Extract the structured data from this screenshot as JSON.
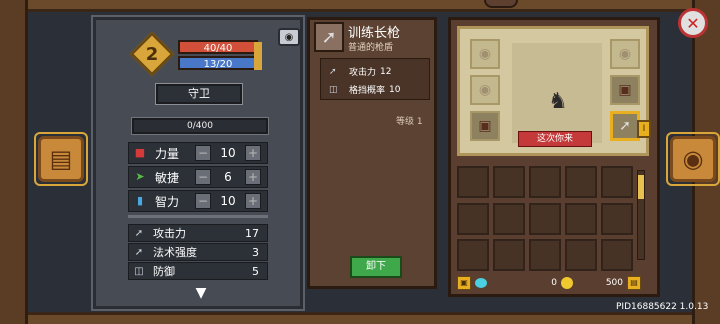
{
  "hero": {
    "level": "2",
    "hp": "40/40",
    "mp": "13/20",
    "role": "守卫",
    "xp": "0/400",
    "camera_icon": "camera-icon"
  },
  "attributes": [
    {
      "name": "力量",
      "value": "10",
      "icon": "strength-icon",
      "color": "#d43a3a"
    },
    {
      "name": "敏捷",
      "value": "6",
      "icon": "agility-icon",
      "color": "#5ab84a"
    },
    {
      "name": "智力",
      "value": "10",
      "icon": "intellect-icon",
      "color": "#4aa8e0"
    }
  ],
  "attr_controls": {
    "minus": "−",
    "plus": "+"
  },
  "stats": [
    {
      "name": "攻击力",
      "value": "17",
      "icon": "sword-icon"
    },
    {
      "name": "法术强度",
      "value": "3",
      "icon": "wand-icon"
    },
    {
      "name": "防御",
      "value": "5",
      "icon": "shield-icon"
    }
  ],
  "item": {
    "name": "训练长枪",
    "type": "普通的枪盾",
    "stats": [
      {
        "name": "攻击力",
        "value": "12",
        "icon": "sword-icon"
      },
      {
        "name": "格挡概率",
        "value": "10",
        "icon": "shield-icon"
      }
    ],
    "level": "等级 1",
    "unequip_label": "卸下"
  },
  "equipment": {
    "greeting": "这次你来",
    "tab_label": "I"
  },
  "currency": {
    "gems": "0",
    "coins": "500"
  },
  "build_id": "PID16885622 1.0.13"
}
